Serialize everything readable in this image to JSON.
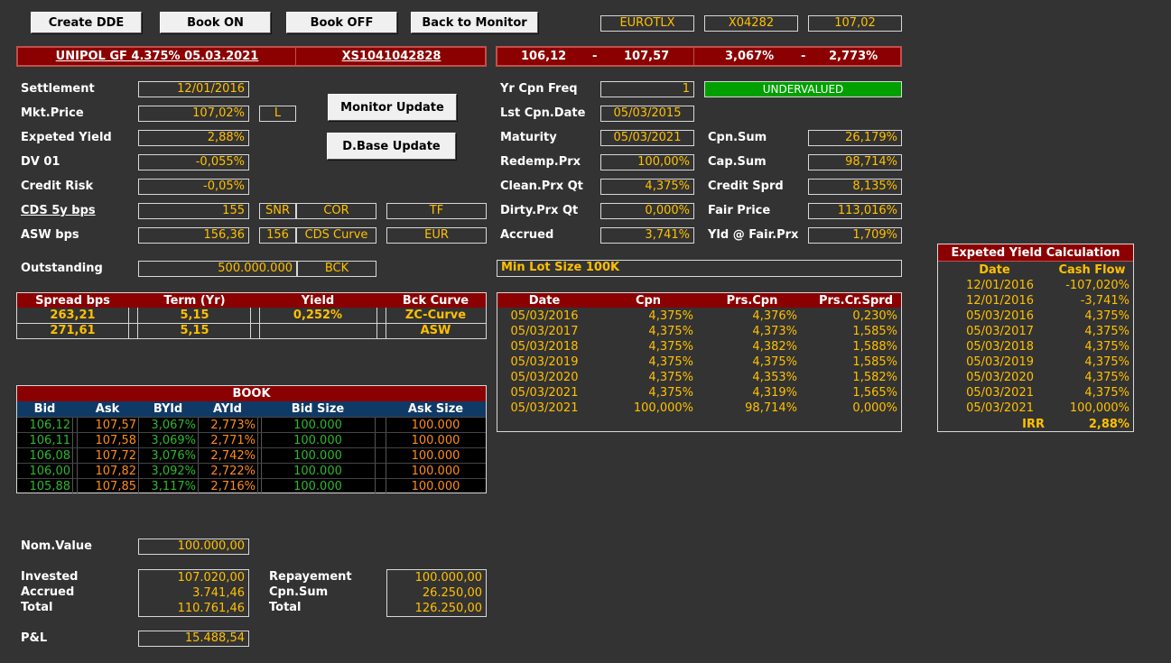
{
  "toolbar": {
    "create_dde": "Create DDE",
    "book_on": "Book ON",
    "book_off": "Book OFF",
    "back_to_monitor": "Back to Monitor",
    "market": "EUROTLX",
    "code": "X04282",
    "price": "107,02"
  },
  "security": {
    "name": "UNIPOL GF 4.375% 05.03.2021",
    "isin": "XS1041042828",
    "bid": "106,12",
    "dash1": "-",
    "ask": "107,57",
    "bid_yield": "3,067%",
    "dash2": "-",
    "ask_yield": "2,773%"
  },
  "left": {
    "settlement_label": "Settlement",
    "settlement": "12/01/2016",
    "mkt_price_label": "Mkt.Price",
    "mkt_price": "107,02%",
    "mkt_flag": "L",
    "exp_yield_label": "Expeted Yield",
    "exp_yield": "2,88%",
    "dv01_label": "DV 01",
    "dv01": "-0,055%",
    "credit_risk_label": "Credit Risk",
    "credit_risk": "-0,05%",
    "cds_label": "CDS 5y bps",
    "cds": "155",
    "cds_snr": "SNR",
    "cds_cor": "COR",
    "cds_tf": "TF",
    "asw_label": "ASW bps",
    "asw": "156,36",
    "asw_156": "156",
    "asw_curve": "CDS Curve",
    "asw_ccy": "EUR",
    "outstanding_label": "Outstanding",
    "outstanding": "500.000.000",
    "outstanding_src": "BCK"
  },
  "buttons": {
    "monitor_update": "Monitor Update",
    "dbase_update": "D.Base Update"
  },
  "mid": {
    "yr_cpn_freq_label": "Yr Cpn Freq",
    "yr_cpn_freq": "1",
    "status": "UNDERVALUED",
    "lst_cpn_label": "Lst Cpn.Date",
    "lst_cpn": "05/03/2015",
    "maturity_label": "Maturity",
    "maturity": "05/03/2021",
    "cpn_sum_label": "Cpn.Sum",
    "cpn_sum": "26,179%",
    "redemp_label": "Redemp.Prx",
    "redemp": "100,00%",
    "cap_sum_label": "Cap.Sum",
    "cap_sum": "98,714%",
    "clean_label": "Clean.Prx Qt",
    "clean": "4,375%",
    "credit_sprd_label": "Credit Sprd",
    "credit_sprd": "8,135%",
    "dirty_label": "Dirty.Prx Qt",
    "dirty": "0,000%",
    "fair_price_label": "Fair Price",
    "fair_price": "113,016%",
    "accrued_label": "Accrued",
    "accrued": "3,741%",
    "yld_fair_label": "Yld @ Fair.Prx",
    "yld_fair": "1,709%",
    "min_lot": "Min Lot Size 100K"
  },
  "spread_table": {
    "headers": [
      "Spread bps",
      "Term (Yr)",
      "Yield",
      "Bck Curve"
    ],
    "rows": [
      [
        "263,21",
        "5,15",
        "0,252%",
        "ZC-Curve"
      ],
      [
        "271,61",
        "5,15",
        "",
        "ASW"
      ]
    ]
  },
  "cpn_table": {
    "headers": [
      "Date",
      "Cpn",
      "Prs.Cpn",
      "Prs.Cr.Sprd"
    ],
    "rows": [
      [
        "05/03/2016",
        "4,375%",
        "4,376%",
        "0,230%"
      ],
      [
        "05/03/2017",
        "4,375%",
        "4,373%",
        "1,585%"
      ],
      [
        "05/03/2018",
        "4,375%",
        "4,382%",
        "1,588%"
      ],
      [
        "05/03/2019",
        "4,375%",
        "4,375%",
        "1,585%"
      ],
      [
        "05/03/2020",
        "4,375%",
        "4,353%",
        "1,582%"
      ],
      [
        "05/03/2021",
        "4,375%",
        "4,319%",
        "1,565%"
      ],
      [
        "05/03/2021",
        "100,000%",
        "98,714%",
        "0,000%"
      ]
    ]
  },
  "book": {
    "title": "BOOK",
    "headers": [
      "Bid",
      "Ask",
      "BYld",
      "AYld",
      "Bid Size",
      "Ask Size"
    ],
    "rows": [
      [
        "106,12",
        "107,57",
        "3,067%",
        "2,773%",
        "100.000",
        "100.000"
      ],
      [
        "106,11",
        "107,58",
        "3,069%",
        "2,771%",
        "100.000",
        "100.000"
      ],
      [
        "106,08",
        "107,72",
        "3,076%",
        "2,742%",
        "100.000",
        "100.000"
      ],
      [
        "106,00",
        "107,82",
        "3,092%",
        "2,722%",
        "100.000",
        "100.000"
      ],
      [
        "105,88",
        "107,85",
        "3,117%",
        "2,716%",
        "100.000",
        "100.000"
      ]
    ]
  },
  "yield_calc": {
    "title": "Expeted Yield Calculation",
    "headers": [
      "Date",
      "Cash Flow"
    ],
    "rows": [
      [
        "12/01/2016",
        "-107,020%"
      ],
      [
        "12/01/2016",
        "-3,741%"
      ],
      [
        "05/03/2016",
        "4,375%"
      ],
      [
        "05/03/2017",
        "4,375%"
      ],
      [
        "05/03/2018",
        "4,375%"
      ],
      [
        "05/03/2019",
        "4,375%"
      ],
      [
        "05/03/2020",
        "4,375%"
      ],
      [
        "05/03/2021",
        "4,375%"
      ],
      [
        "05/03/2021",
        "100,000%"
      ]
    ],
    "irr_label": "IRR",
    "irr": "2,88%"
  },
  "pnl": {
    "nom_label": "Nom.Value",
    "nom": "100.000,00",
    "invested_label": "Invested",
    "invested": "107.020,00",
    "accrued_label": "Accrued",
    "accrued": "3.741,46",
    "total_label": "Total",
    "total": "110.761,46",
    "repay_label": "Repayement",
    "repay": "100.000,00",
    "cpnsum_label": "Cpn.Sum",
    "cpnsum": "26.250,00",
    "total2_label": "Total",
    "total2": "126.250,00",
    "pl_label": "P&L",
    "pl": "15.488,54"
  },
  "colors": {
    "background": "#333333",
    "accent_red": "#8b0000",
    "value_gold": "#ffc000",
    "status_green": "#00a000",
    "book_header_blue": "#1f4e79",
    "bid_green": "#2db82d",
    "ask_orange": "#ff8c1a"
  }
}
